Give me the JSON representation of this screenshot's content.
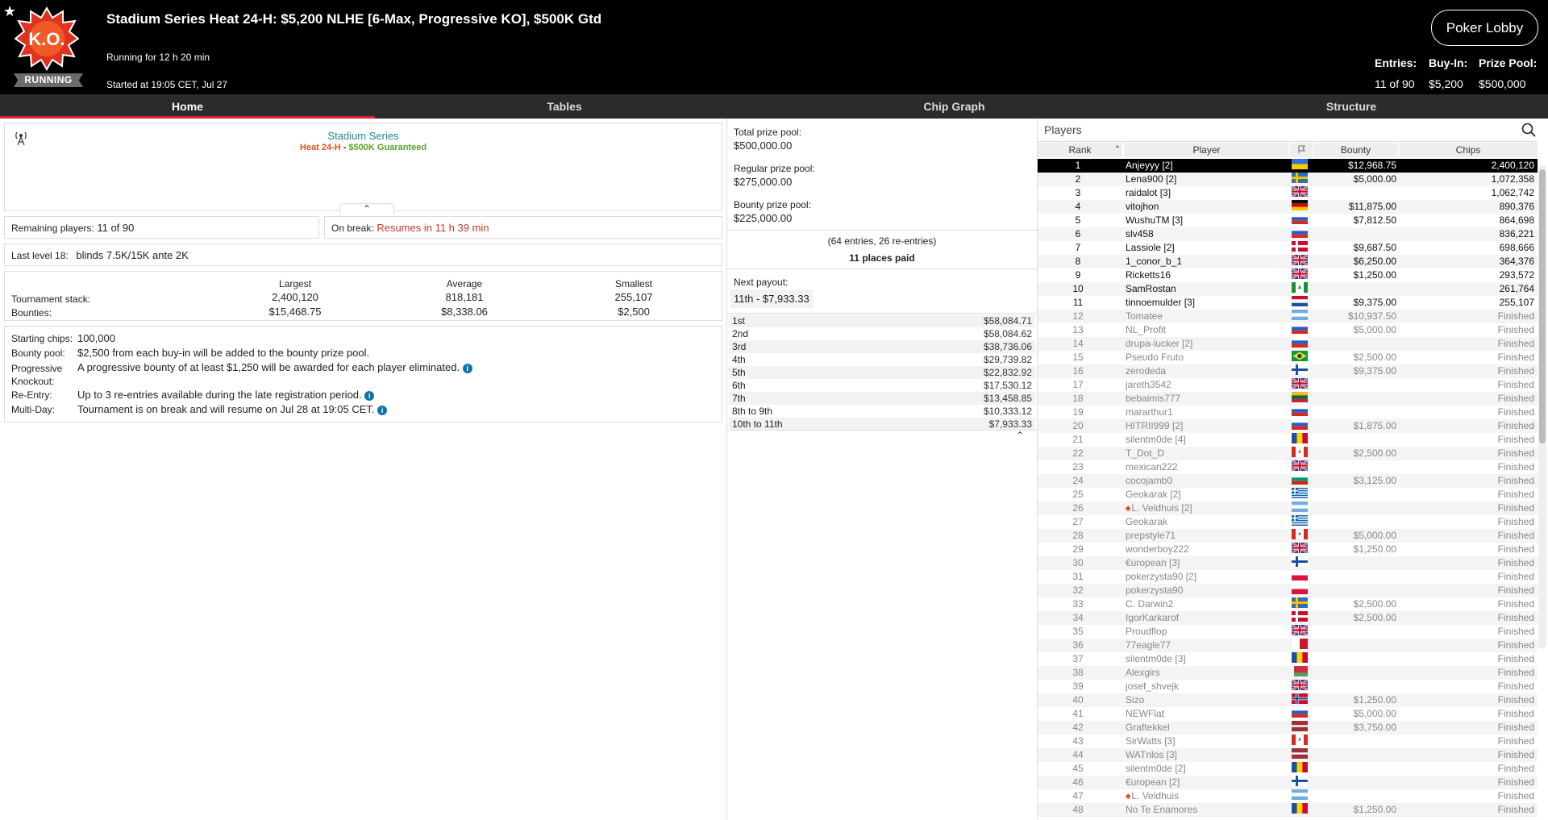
{
  "header": {
    "status": "RUNNING",
    "logo_text": "K.O.",
    "title": "Stadium Series Heat 24-H: $5,200 NLHE [6-Max, Progressive KO], $500K Gtd",
    "running_for": "Running for 12 h 20 min",
    "started_at": "Started at 19:05 CET, Jul 27",
    "lobby_button": "Poker Lobby",
    "entries_label": "Entries:",
    "entries_value": "11 of 90",
    "buyin_label": "Buy-In:",
    "buyin_value": "$5,200",
    "prizepool_label": "Prize Pool:",
    "prizepool_value": "$500,000"
  },
  "tabs": [
    "Home",
    "Tables",
    "Chip Graph",
    "Structure"
  ],
  "banner": {
    "line1": "Stadium Series",
    "line2a": "Heat 24-H",
    "line2b": " - ",
    "line2c": "$500K Guaranteed"
  },
  "status": {
    "remaining_label": "Remaining players:",
    "remaining_value": "11 of 90",
    "break_label": "On break:",
    "break_value": "Resumes in 11 h 39 min",
    "level_label": "Last level 18:",
    "level_value": "blinds 7.5K/15K ante 2K"
  },
  "stacks": {
    "headers": [
      "Largest",
      "Average",
      "Smallest"
    ],
    "tournament_label": "Tournament stack:",
    "tournament": [
      "2,400,120",
      "818,181",
      "255,107"
    ],
    "bounties_label": "Bounties:",
    "bounties": [
      "$15,468.75",
      "$8,338.06",
      "$2,500"
    ]
  },
  "info": {
    "starting_chips_label": "Starting chips:",
    "starting_chips": "100,000",
    "bounty_pool_label": "Bounty pool:",
    "bounty_pool": "$2,500 from each buy-in will be added to the bounty prize pool.",
    "progressive_label": "Progressive Knockout:",
    "progressive": "A progressive bounty of at least $1,250 will be awarded for each player eliminated.",
    "reentry_label": "Re-Entry:",
    "reentry": "Up to 3 re-entries available during the late registration period.",
    "multiday_label": "Multi-Day:",
    "multiday": "Tournament is on break and will resume on Jul 28 at 19:05 CET."
  },
  "prize": {
    "total_label": "Total prize pool:",
    "total": "$500,000.00",
    "regular_label": "Regular prize pool:",
    "regular": "$275,000.00",
    "bounty_label": "Bounty prize pool:",
    "bounty": "$225,000.00",
    "entries_note": "(64 entries, 26 re-entries)",
    "places_paid": "11 places paid",
    "next_payout_label": "Next payout:",
    "next_payout": "11th - $7,933.33",
    "payouts": [
      [
        "1st",
        "$58,084.71"
      ],
      [
        "2nd",
        "$58,084.62"
      ],
      [
        "3rd",
        "$38,736.06"
      ],
      [
        "4th",
        "$29,739.82"
      ],
      [
        "5th",
        "$22,832.92"
      ],
      [
        "6th",
        "$17,530.12"
      ],
      [
        "7th",
        "$13,458.85"
      ],
      [
        "8th to 9th",
        "$10,333.12"
      ],
      [
        "10th to 11th",
        "$7,933.33"
      ]
    ]
  },
  "players": {
    "title": "Players",
    "columns": [
      "Rank",
      "Player",
      "Bounty",
      "Chips"
    ],
    "rows": [
      [
        "1",
        "Anjeyyy [2]",
        "$12,968.75",
        "2,400,120",
        "ua"
      ],
      [
        "2",
        "Lena900 [2]",
        "$5,000.00",
        "1,072,358",
        "se"
      ],
      [
        "3",
        "raidalot [3]",
        "",
        "1,062,742",
        "gb"
      ],
      [
        "4",
        "vitojhon",
        "$11,875.00",
        "890,376",
        "de"
      ],
      [
        "5",
        "WushuTM [3]",
        "$7,812.50",
        "864,698",
        "ru"
      ],
      [
        "6",
        "slv458",
        "",
        "836,221",
        "ru"
      ],
      [
        "7",
        "Lassiole [2]",
        "$9,687.50",
        "698,666",
        "dk"
      ],
      [
        "8",
        "1_conor_b_1",
        "$6,250.00",
        "364,376",
        "gb"
      ],
      [
        "9",
        "Ricketts16",
        "$1,250.00",
        "293,572",
        "gb"
      ],
      [
        "10",
        "SamRostan",
        "",
        "261,764",
        "ca2"
      ],
      [
        "11",
        "tinnoemulder [3]",
        "$9,375.00",
        "255,107",
        "nl"
      ],
      [
        "12",
        "Tomatee",
        "$10,937.50",
        "Finished",
        "ar"
      ],
      [
        "13",
        "NL_Profit",
        "$5,000.00",
        "Finished",
        "ru"
      ],
      [
        "14",
        "drupa-lucker [2]",
        "",
        "Finished",
        "ru"
      ],
      [
        "15",
        "Pseudo Fruto",
        "$2,500.00",
        "Finished",
        "br"
      ],
      [
        "16",
        "zerodeda",
        "$9,375.00",
        "Finished",
        "fi"
      ],
      [
        "17",
        "jareth3542",
        "",
        "Finished",
        "gb"
      ],
      [
        "18",
        "bebaimis777",
        "",
        "Finished",
        "lt"
      ],
      [
        "19",
        "mararthur1",
        "",
        "Finished",
        "ru"
      ],
      [
        "20",
        "HITRII999 [2]",
        "$1,875.00",
        "Finished",
        "ru"
      ],
      [
        "21",
        "silentm0de [4]",
        "",
        "Finished",
        "md"
      ],
      [
        "22",
        "T_Dot_D",
        "$2,500.00",
        "Finished",
        "ca"
      ],
      [
        "23",
        "mexican222",
        "",
        "Finished",
        "gb"
      ],
      [
        "24",
        "cocojamb0",
        "$3,125.00",
        "Finished",
        "bg"
      ],
      [
        "25",
        "Geokarak [2]",
        "",
        "Finished",
        "gr"
      ],
      [
        "26",
        "L. Veldhuis [2]",
        "",
        "Finished",
        "ar"
      ],
      [
        "27",
        "Geokarak",
        "",
        "Finished",
        "gr"
      ],
      [
        "28",
        "prepstyle71",
        "$5,000.00",
        "Finished",
        "ca"
      ],
      [
        "29",
        "wonderboy222",
        "$1,250.00",
        "Finished",
        "gb"
      ],
      [
        "30",
        "€uropean [3]",
        "",
        "Finished",
        "fi"
      ],
      [
        "31",
        "pokerzysta90 [2]",
        "",
        "Finished",
        "pl"
      ],
      [
        "32",
        "pokerzysta90",
        "",
        "Finished",
        "pl"
      ],
      [
        "33",
        "C. Darwin2",
        "$2,500.00",
        "Finished",
        "se"
      ],
      [
        "34",
        "IgorKarkarof",
        "$2,500.00",
        "Finished",
        "dk"
      ],
      [
        "35",
        "Proudflop",
        "",
        "Finished",
        "gb"
      ],
      [
        "36",
        "77eagle77",
        "",
        "Finished",
        "mt"
      ],
      [
        "37",
        "silentm0de [3]",
        "",
        "Finished",
        "md"
      ],
      [
        "38",
        "Alexgirs",
        "",
        "Finished",
        "by"
      ],
      [
        "39",
        "josef_shvejk",
        "",
        "Finished",
        "gb"
      ],
      [
        "40",
        "Sizo",
        "$1,250.00",
        "Finished",
        "no"
      ],
      [
        "41",
        "NEWFlat",
        "$5,000.00",
        "Finished",
        "ru"
      ],
      [
        "42",
        "Graftekkel",
        "$3,750.00",
        "Finished",
        "lv"
      ],
      [
        "43",
        "SirWatts [3]",
        "",
        "Finished",
        "ca"
      ],
      [
        "44",
        "WATnlos [3]",
        "",
        "Finished",
        "lv"
      ],
      [
        "45",
        "silentm0de [2]",
        "",
        "Finished",
        "md"
      ],
      [
        "46",
        "€uropean [2]",
        "",
        "Finished",
        "fi"
      ],
      [
        "47",
        "L. Veldhuis",
        "",
        "Finished",
        "ar"
      ],
      [
        "48",
        "No Te Enamores",
        "$1,250.00",
        "Finished",
        "md"
      ]
    ]
  }
}
